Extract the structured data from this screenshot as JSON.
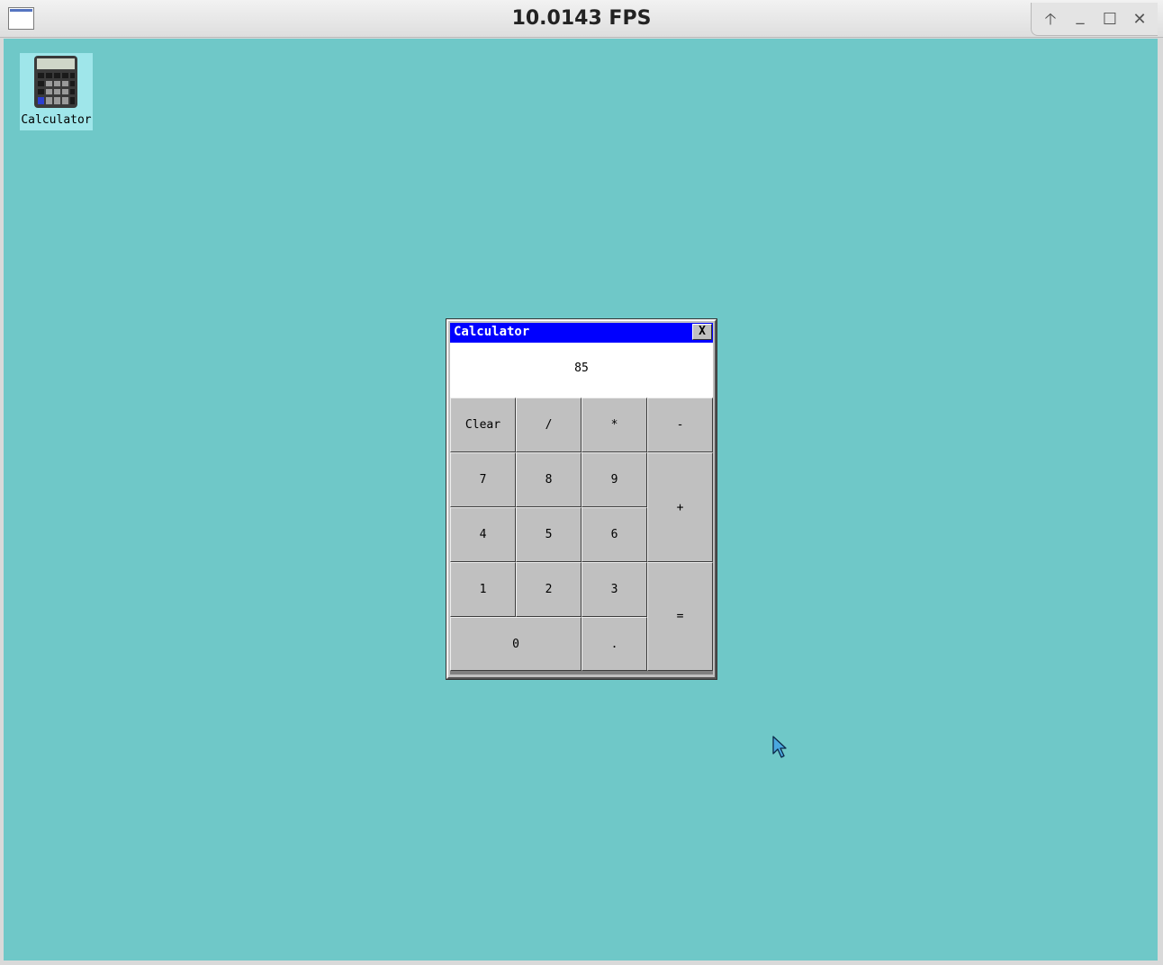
{
  "host_window": {
    "title": "10.0143 FPS",
    "controls": [
      {
        "name": "keep-above-icon",
        "glyph": "🡡"
      },
      {
        "name": "minimize-icon",
        "glyph": "_"
      },
      {
        "name": "maximize-icon",
        "glyph": "☐"
      },
      {
        "name": "close-icon",
        "glyph": "✕"
      }
    ]
  },
  "desktop": {
    "background": "#6fc8c8",
    "icons": [
      {
        "label": "Calculator",
        "icon": "calculator-icon"
      }
    ]
  },
  "calculator": {
    "title": "Calculator",
    "close_label": "X",
    "display": "85",
    "title_color": "#0000ff",
    "keys": {
      "clear": "Clear",
      "divide": "/",
      "multiply": "*",
      "minus": "-",
      "seven": "7",
      "eight": "8",
      "nine": "9",
      "plus": "+",
      "four": "4",
      "five": "5",
      "six": "6",
      "one": "1",
      "two": "2",
      "three": "3",
      "equals": "=",
      "zero": "0",
      "dot": "."
    }
  }
}
